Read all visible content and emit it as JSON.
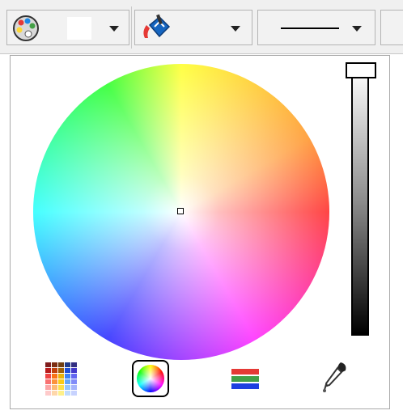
{
  "toolbar": {
    "groups": [
      {
        "name": "fill-color",
        "icon": "palette-icon",
        "current_color": "#ffffff"
      },
      {
        "name": "paint-bucket",
        "icon": "paint-bucket-icon"
      },
      {
        "name": "line-style",
        "icon": "line-style-icon"
      }
    ]
  },
  "color_picker": {
    "mode": "color-wheel",
    "brightness_fraction": 1.0,
    "selected_color": "#ffffff",
    "modes": [
      {
        "name": "swatches",
        "icon": "swatch-grid-icon",
        "active": false
      },
      {
        "name": "color-wheel",
        "icon": "color-wheel-icon",
        "active": true
      },
      {
        "name": "rgb-sliders",
        "icon": "rgb-sliders-icon",
        "active": false
      },
      {
        "name": "eyedropper",
        "icon": "eyedropper-icon",
        "active": false
      }
    ]
  }
}
